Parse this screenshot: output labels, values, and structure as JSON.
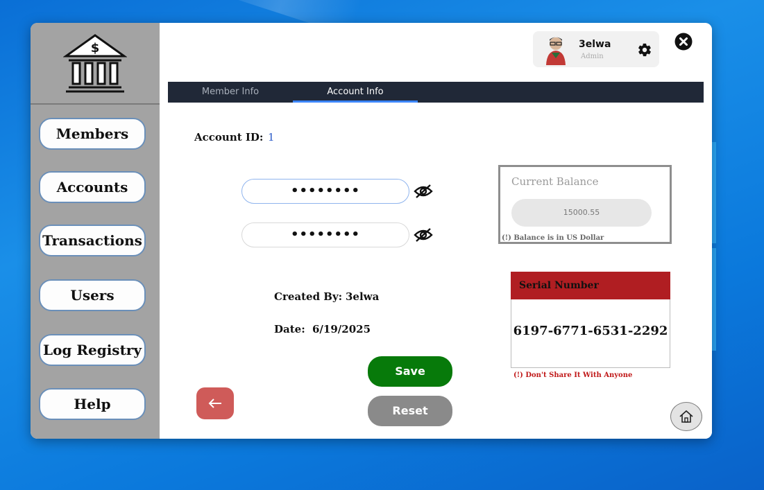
{
  "sidebar": {
    "logo_icon": "bank-icon",
    "items": [
      {
        "label": "Members"
      },
      {
        "label": "Accounts"
      },
      {
        "label": "Transactions"
      },
      {
        "label": "Users"
      },
      {
        "label": "Log Registry"
      },
      {
        "label": "Help"
      }
    ]
  },
  "user": {
    "name": "3elwa",
    "role": "Admin",
    "settings_icon": "gear-icon"
  },
  "tabs": [
    {
      "label": "Member Info",
      "active": false
    },
    {
      "label": "Account Info",
      "active": true
    }
  ],
  "account": {
    "id_label": "Account ID:",
    "id_value": "1",
    "password_value": "••••••••",
    "confirm_value": "••••••••",
    "created_by_label": "Created By:",
    "created_by_value": "3elwa",
    "date_label": "Date:",
    "date_value": "6/19/2025"
  },
  "balance": {
    "title": "Current Balance",
    "value": "15000.55",
    "note": "(!) Balance is in US Dollar"
  },
  "serial": {
    "title": "Serial Number",
    "value": "6197-6771-6531-2292",
    "warning": "(!) Don't Share It With Anyone"
  },
  "actions": {
    "save": "Save",
    "reset": "Reset"
  },
  "colors": {
    "sidebar_bg": "#a3a3a3",
    "tabbar_bg": "#202837",
    "save_bg": "#077a0a",
    "reset_bg": "#8a8a8a",
    "back_bg": "#cf5b59",
    "serial_header": "#b01e22",
    "accent_blue": "#3c86ff"
  }
}
